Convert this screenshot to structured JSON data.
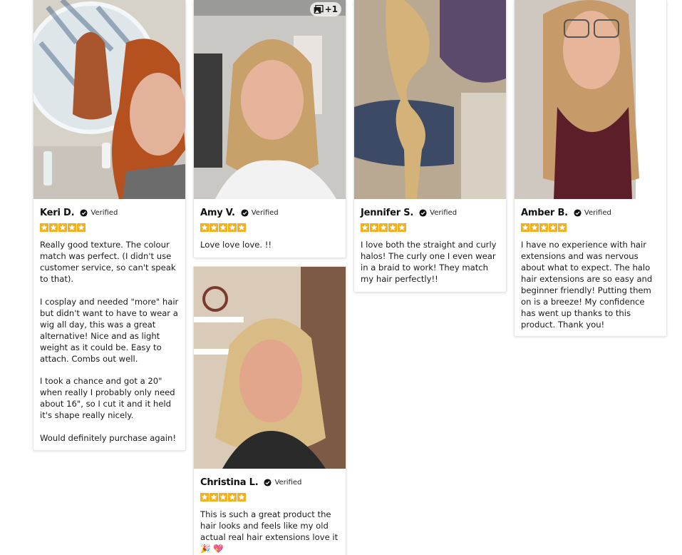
{
  "reviews": [
    {
      "name": "Keri D.",
      "verified_label": "Verified",
      "rating": 5,
      "paragraphs": [
        "Really good texture.  The colour match was perfect. (I didn't use customer service, so can't speak to that).",
        "I cosplay and needed \"more\" hair but didn't want to have to wear a wig all day, this was a great alternative! Nice and as light weight as it could be. Easy to attach.  Combs out well.",
        "I took a chance and got a 20\" when really I probably only need about 16\", so I cut it and it held it's shape really nicely.",
        "Would definitely purchase again!"
      ]
    },
    {
      "name": "Amy V.",
      "verified_label": "Verified",
      "rating": 5,
      "media_badge": "+1",
      "paragraphs": [
        "Love love love. !!"
      ]
    },
    {
      "name": "Christina L.",
      "verified_label": "Verified",
      "rating": 5,
      "paragraphs": [
        "This is such a great product the hair looks and feels like my old actual real hair extensions love it 🎉 💖"
      ]
    },
    {
      "name": "Jennifer S.",
      "verified_label": "Verified",
      "rating": 5,
      "paragraphs": [
        "I love both the straight and curly halos! The curly one I even wear in a braid to work! They match my hair perfectly!!"
      ]
    },
    {
      "name": "Amber B.",
      "verified_label": "Verified",
      "rating": 5,
      "paragraphs": [
        "I have no experience with hair extensions and was nervous about what to expect. The halo hair extensions are so easy and beginner friendly! Putting them on is a breeze! My confidence has went up thanks to this product. Thank you!"
      ]
    }
  ],
  "colors": {
    "star": "#f2b01e",
    "verified": "#111111"
  },
  "icons": {
    "verified": "check-circle-icon",
    "star": "star-icon",
    "media": "gallery-icon"
  }
}
